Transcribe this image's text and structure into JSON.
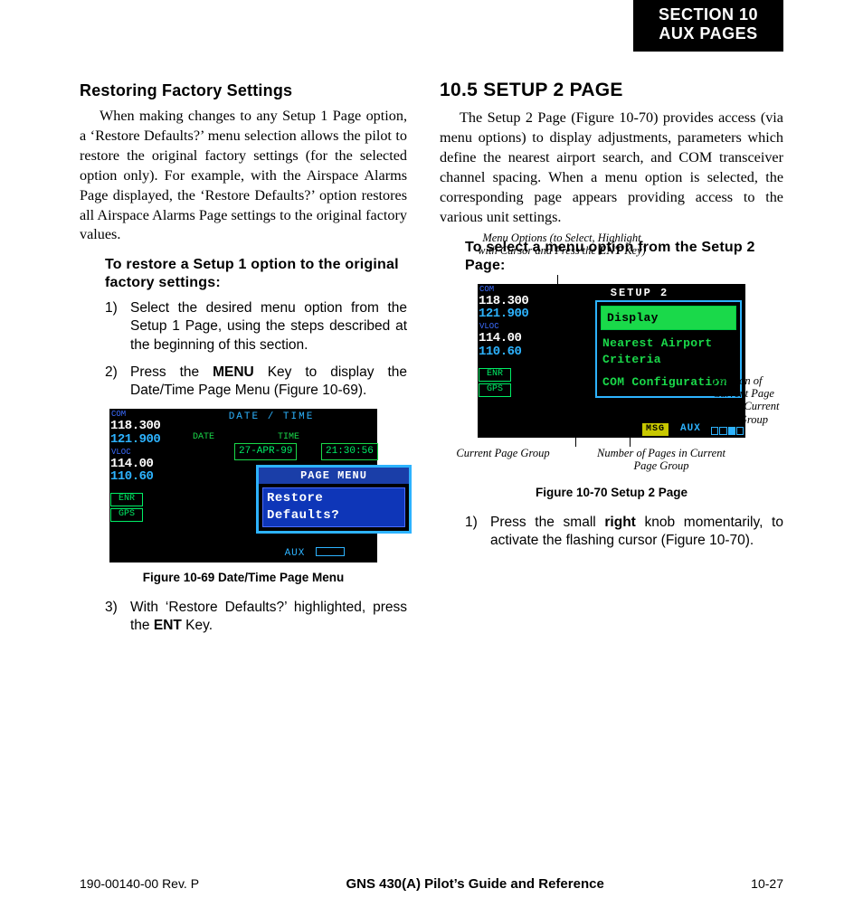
{
  "section_tab": {
    "line1": "SECTION 10",
    "line2": "AUX PAGES"
  },
  "left": {
    "subhead": "Restoring Factory Settings",
    "para": "When making changes to any Setup 1 Page option, a ‘Restore Defaults?’ menu selection allows the pilot to restore the original factory settings (for the selected option only). For example, with the Airspace Alarms Page displayed, the ‘Restore Defaults?’ option restores all Airspace Alarms Page settings to the original factory values.",
    "instr_head": "To restore a Setup 1 option to the original factory settings:",
    "steps": {
      "s1": "Select the desired menu option from the Setup 1 Page, using the steps described at the beginning of this section.",
      "s2_a": "Press the ",
      "s2_key": "MENU",
      "s2_b": " Key to display the Date/Time Page Menu (Figure 10-69).",
      "s3_a": "With ‘Restore Defaults?’ highlighted, press the ",
      "s3_key": "ENT",
      "s3_b": " Key."
    },
    "fig69": {
      "caption": "Figure 10-69  Date/Time Page Menu",
      "title": "DATE / TIME",
      "lbl_date": "DATE",
      "lbl_time": "TIME",
      "date_val": "27-APR-99",
      "time_val": "21:30:56",
      "menu_bar": "PAGE MENU",
      "menu_opt": "Restore Defaults?",
      "aux": "AUX"
    }
  },
  "right": {
    "head": "10.5  SETUP 2 PAGE",
    "para": "The Setup 2 Page (Figure 10-70) provides access (via menu options) to display adjustments, parameters which define the nearest airport search, and COM transceiver channel spacing.  When a menu option is selected, the corresponding page appears providing access to the various unit settings.",
    "instr_head": "To select a menu option from the Setup 2 Page:",
    "callouts": {
      "top_a": "Menu Options (to Select, Highlight with Cursor and Press the ",
      "top_key": "ENT",
      "top_b": " Key)",
      "right": "Position of Current Page within Current Page Group",
      "bl": "Current Page Group",
      "br": "Number of Pages in Current Page Group"
    },
    "fig70": {
      "caption": "Figure 10-70  Setup 2 Page",
      "title": "SETUP 2",
      "items": {
        "i0": "Display",
        "i1": "Nearest Airport Criteria",
        "i2": "COM Configuration"
      },
      "msg": "MSG",
      "aux": "AUX"
    },
    "steps": {
      "s1_a": "Press the small ",
      "s1_key": "right",
      "s1_b": " knob momentarily, to activate the flashing cursor (Figure 10-70)."
    }
  },
  "device_left": {
    "com_lbl": "COM",
    "com_act": "118.300",
    "com_sby": "121.900",
    "vloc_lbl": "VLOC",
    "vloc_act": "114.00",
    "vloc_sby": "110.60",
    "enr": "ENR",
    "gps": "GPS"
  },
  "footer": {
    "left": "190-00140-00  Rev. P",
    "center": "GNS 430(A) Pilot’s Guide and Reference",
    "right": "10-27"
  }
}
